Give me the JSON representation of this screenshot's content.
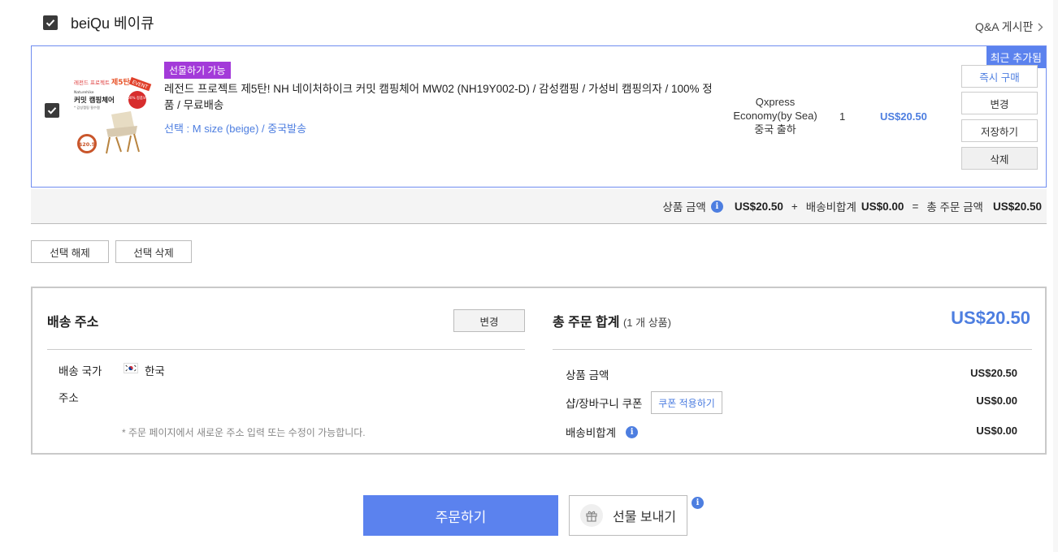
{
  "shop": {
    "name": "beiQu 베이큐",
    "qa_link": "Q&A 게시판"
  },
  "item": {
    "recent_badge": "최근 추가됨",
    "gift_tag": "선물하기 가능",
    "title": "레전드 프로젝트 제5탄! NH 네이처하이크 커밋 캠핑체어 MW02 (NH19Y002-D) / 감성캠핑 / 가성비 캠핑의자 / 100% 정품 / 무료배송",
    "option": "선택 : M size (beige) / 중국발송",
    "shipping_method": "Qxpress",
    "shipping_type": "Economy(by Sea)",
    "shipping_origin": "중국 출하",
    "quantity": "1",
    "price": "US$20.50",
    "thumb": {
      "top_text": "레전드 프로젝트",
      "edition": "제5탄",
      "brand": "Naturehike",
      "product": "커밋 캠핑체어",
      "sub": "* 감성캠핑 필수템",
      "badge": "100% 정품보장",
      "event": "EVENT",
      "coupon": "$20.5"
    },
    "buttons": {
      "buy_now": "즉시 구매",
      "change": "변경",
      "save": "저장하기",
      "delete": "삭제"
    }
  },
  "summary": {
    "product_label": "상품 금액",
    "product_amount": "US$20.50",
    "plus": "+",
    "shipping_label": "배송비합계",
    "shipping_amount": "US$0.00",
    "equals": "=",
    "total_label": "총 주문 금액",
    "total_amount": "US$20.50"
  },
  "selection": {
    "deselect": "선택 해제",
    "delete_selected": "선택 삭제"
  },
  "address": {
    "title": "배송 주소",
    "change": "변경",
    "country_label": "배송 국가",
    "country": "한국",
    "address_label": "주소",
    "note": "* 주문 페이지에서 새로운 주소 입력 또는 수정이 가능합니다."
  },
  "order_total": {
    "title": "총 주문 합계",
    "count": "(1 개 상품)",
    "amount": "US$20.50",
    "rows": {
      "product_label": "상품 금액",
      "product_value": "US$20.50",
      "coupon_label": "샵/장바구니 쿠폰",
      "coupon_button": "쿠폰 적용하기",
      "coupon_value": "US$0.00",
      "shipping_label": "배송비합계",
      "shipping_value": "US$0.00"
    }
  },
  "actions": {
    "order": "주문하기",
    "send_gift": "선물 보내기"
  },
  "colors": {
    "accent": "#5b82ee",
    "price_blue": "#4d7ee0",
    "gift_tag": "#a33ad9"
  }
}
